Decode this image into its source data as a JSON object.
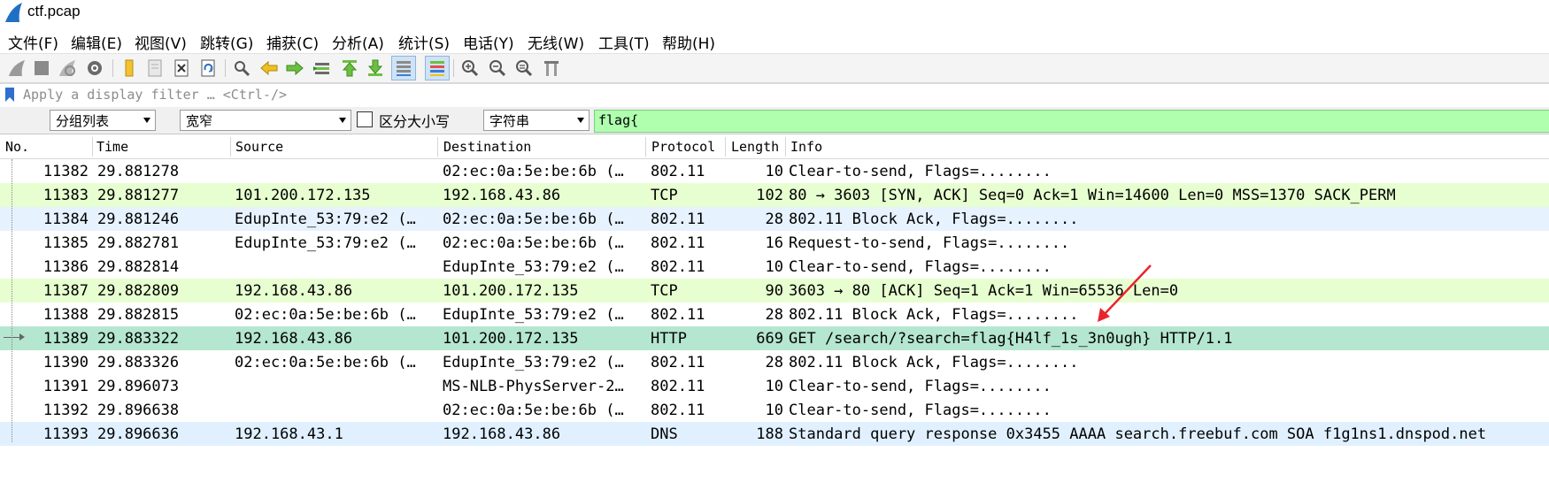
{
  "window": {
    "title": "ctf.pcap"
  },
  "menu": [
    "文件(F)",
    "编辑(E)",
    "视图(V)",
    "跳转(G)",
    "捕获(C)",
    "分析(A)",
    "统计(S)",
    "电话(Y)",
    "无线(W)",
    "工具(T)",
    "帮助(H)"
  ],
  "toolbar": {
    "icons": [
      "start-capture-icon",
      "stop-capture-icon",
      "restart-capture-icon",
      "capture-options-icon",
      "open-file-icon",
      "save-file-icon",
      "close-file-icon",
      "reload-file-icon",
      "find-packet-icon",
      "go-back-icon",
      "go-forward-icon",
      "go-to-packet-icon",
      "go-first-icon",
      "go-last-icon",
      "auto-scroll-icon",
      "colorize-icon",
      "zoom-in-icon",
      "zoom-out-icon",
      "normal-size-icon",
      "resize-columns-icon"
    ],
    "active": [
      "auto-scroll-icon",
      "colorize-icon"
    ]
  },
  "filter": {
    "placeholder": "Apply a display filter … <Ctrl-/>"
  },
  "find": {
    "scope": "分组列表",
    "charset": "宽窄",
    "case_label": "区分大小写",
    "case_checked": false,
    "type": "字符串",
    "query": "flag{"
  },
  "columns": [
    "No.",
    "Time",
    "Source",
    "Destination",
    "Protocol",
    "Length",
    "Info"
  ],
  "colors": {
    "wireless": "#ffffff",
    "tcp": "#e7ffd0",
    "blockack": "#e7f2ff",
    "http": "#b5e6cf",
    "dns": "#e0f0ff",
    "annotation": "#e8242b"
  },
  "packets": [
    {
      "no": "11382",
      "time": "29.881278",
      "source": "",
      "destination": "02:ec:0a:5e:be:6b (…",
      "protocol": "802.11",
      "length": "10",
      "info": "Clear-to-send, Flags=........",
      "color": "wireless"
    },
    {
      "no": "11383",
      "time": "29.881277",
      "source": "101.200.172.135",
      "destination": "192.168.43.86",
      "protocol": "TCP",
      "length": "102",
      "info": "80 → 3603 [SYN, ACK] Seq=0 Ack=1 Win=14600 Len=0 MSS=1370 SACK_PERM",
      "color": "tcp"
    },
    {
      "no": "11384",
      "time": "29.881246",
      "source": "EdupInte_53:79:e2 (…",
      "destination": "02:ec:0a:5e:be:6b (…",
      "protocol": "802.11",
      "length": "28",
      "info": "802.11 Block Ack, Flags=........",
      "color": "blockack"
    },
    {
      "no": "11385",
      "time": "29.882781",
      "source": "EdupInte_53:79:e2 (…",
      "destination": "02:ec:0a:5e:be:6b (…",
      "protocol": "802.11",
      "length": "16",
      "info": "Request-to-send, Flags=........",
      "color": "wireless"
    },
    {
      "no": "11386",
      "time": "29.882814",
      "source": "",
      "destination": "EdupInte_53:79:e2 (…",
      "protocol": "802.11",
      "length": "10",
      "info": "Clear-to-send, Flags=........",
      "color": "wireless"
    },
    {
      "no": "11387",
      "time": "29.882809",
      "source": "192.168.43.86",
      "destination": "101.200.172.135",
      "protocol": "TCP",
      "length": "90",
      "info": "3603 → 80 [ACK] Seq=1 Ack=1 Win=65536 Len=0",
      "color": "tcp"
    },
    {
      "no": "11388",
      "time": "29.882815",
      "source": "02:ec:0a:5e:be:6b (…",
      "destination": "EdupInte_53:79:e2 (…",
      "protocol": "802.11",
      "length": "28",
      "info": "802.11 Block Ack, Flags=........",
      "color": "wireless"
    },
    {
      "no": "11389",
      "time": "29.883322",
      "source": "192.168.43.86",
      "destination": "101.200.172.135",
      "protocol": "HTTP",
      "length": "669",
      "info": "GET /search/?search=flag{H4lf_1s_3n0ugh} HTTP/1.1",
      "color": "http",
      "selected": true
    },
    {
      "no": "11390",
      "time": "29.883326",
      "source": "02:ec:0a:5e:be:6b (…",
      "destination": "EdupInte_53:79:e2 (…",
      "protocol": "802.11",
      "length": "28",
      "info": "802.11 Block Ack, Flags=........",
      "color": "wireless"
    },
    {
      "no": "11391",
      "time": "29.896073",
      "source": "",
      "destination": "MS-NLB-PhysServer-2…",
      "protocol": "802.11",
      "length": "10",
      "info": "Clear-to-send, Flags=........",
      "color": "wireless"
    },
    {
      "no": "11392",
      "time": "29.896638",
      "source": "",
      "destination": "02:ec:0a:5e:be:6b (…",
      "protocol": "802.11",
      "length": "10",
      "info": "Clear-to-send, Flags=........",
      "color": "wireless"
    },
    {
      "no": "11393",
      "time": "29.896636",
      "source": "192.168.43.1",
      "destination": "192.168.43.86",
      "protocol": "DNS",
      "length": "188",
      "info": "Standard query response 0x3455 AAAA search.freebuf.com SOA f1g1ns1.dnspod.net",
      "color": "dns"
    }
  ]
}
